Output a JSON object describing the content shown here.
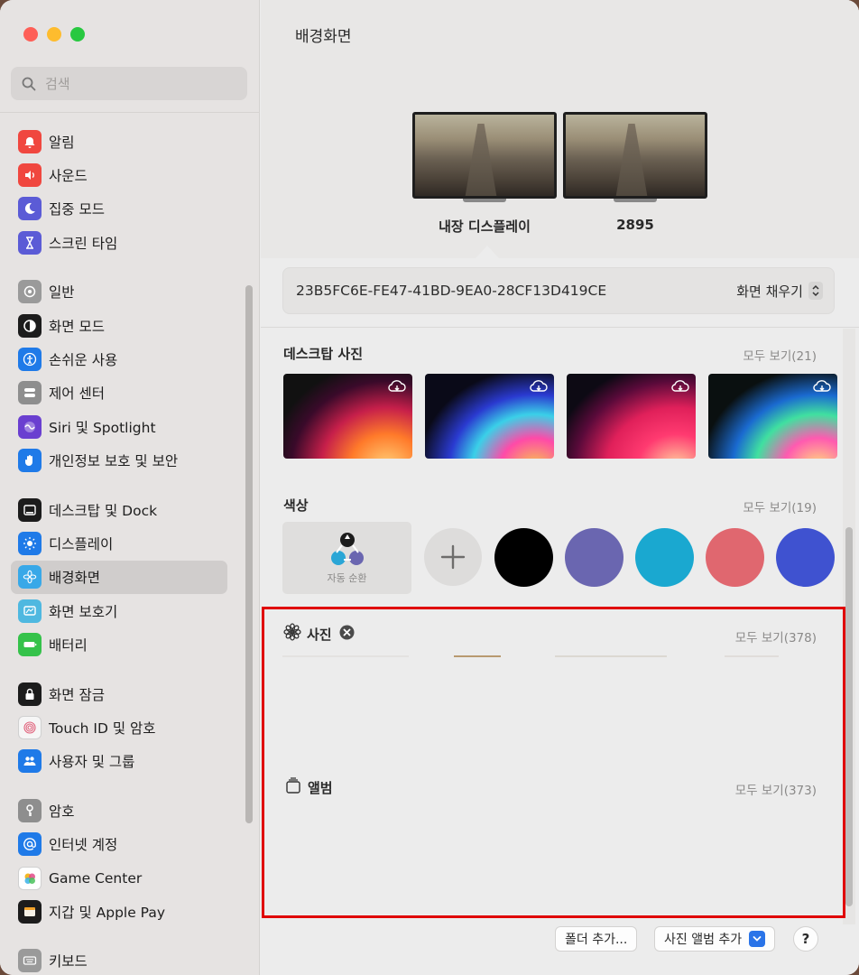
{
  "window": {
    "traffic_colors": [
      "#fe5f57",
      "#febc2e",
      "#28c840"
    ]
  },
  "search": {
    "placeholder": "검색"
  },
  "sidebar": {
    "groups": [
      [
        {
          "id": "notifications",
          "label": "알림",
          "icon": "bell-icon",
          "color": "#f0473f"
        },
        {
          "id": "sound",
          "label": "사운드",
          "icon": "speaker-icon",
          "color": "#f0473f"
        },
        {
          "id": "focus",
          "label": "집중 모드",
          "icon": "moon-icon",
          "color": "#5b5bd6"
        },
        {
          "id": "screen-time",
          "label": "스크린 타임",
          "icon": "hourglass-icon",
          "color": "#5b5bd6"
        }
      ],
      [
        {
          "id": "general",
          "label": "일반",
          "icon": "gear-icon",
          "color": "#9a9a9a"
        },
        {
          "id": "appearance",
          "label": "화면 모드",
          "icon": "appearance-icon",
          "color": "#1c1c1c"
        },
        {
          "id": "accessibility",
          "label": "손쉬운 사용",
          "icon": "accessibility-icon",
          "color": "#1f7ae8"
        },
        {
          "id": "control-center",
          "label": "제어 센터",
          "icon": "control-center-icon",
          "color": "#8e8e8e"
        },
        {
          "id": "siri",
          "label": "Siri 및 Spotlight",
          "icon": "siri-icon",
          "color": "#6a3fd0"
        },
        {
          "id": "privacy",
          "label": "개인정보 보호 및 보안",
          "icon": "hand-icon",
          "color": "#1f7ae8"
        }
      ],
      [
        {
          "id": "desktop-dock",
          "label": "데스크탑 및 Dock",
          "icon": "dock-icon",
          "color": "#1c1c1c"
        },
        {
          "id": "displays",
          "label": "디스플레이",
          "icon": "sun-icon",
          "color": "#1f7ae8"
        },
        {
          "id": "wallpaper",
          "label": "배경화면",
          "icon": "flower-icon",
          "color": "#38a8e8",
          "active": true
        },
        {
          "id": "screensaver",
          "label": "화면 보호기",
          "icon": "screensaver-icon",
          "color": "#4fb8e0"
        },
        {
          "id": "battery",
          "label": "배터리",
          "icon": "battery-icon",
          "color": "#35c24a"
        }
      ],
      [
        {
          "id": "lock-screen",
          "label": "화면 잠금",
          "icon": "lock-icon",
          "color": "#1c1c1c"
        },
        {
          "id": "touch-id",
          "label": "Touch ID 및 암호",
          "icon": "fingerprint-icon",
          "color": "#f6f6f6"
        },
        {
          "id": "users",
          "label": "사용자 및 그룹",
          "icon": "users-icon",
          "color": "#1f7ae8"
        }
      ],
      [
        {
          "id": "passwords",
          "label": "암호",
          "icon": "key-icon",
          "color": "#8e8e8e"
        },
        {
          "id": "internet-accounts",
          "label": "인터넷 계정",
          "icon": "at-icon",
          "color": "#1f7ae8"
        },
        {
          "id": "game-center",
          "label": "Game Center",
          "icon": "game-center-icon",
          "color": "#ffffff"
        },
        {
          "id": "wallet",
          "label": "지갑 및 Apple Pay",
          "icon": "wallet-icon",
          "color": "#1c1c1c"
        }
      ],
      [
        {
          "id": "keyboard",
          "label": "키보드",
          "icon": "keyboard-icon",
          "color": "#9a9a9a"
        }
      ]
    ]
  },
  "main": {
    "title": "배경화면",
    "displays": [
      {
        "label": "내장 디스플레이"
      },
      {
        "label": "2895"
      }
    ],
    "selector": {
      "wallpaper_id": "23B5FC6E-FE47-41BD-9EA0-28CF13D419CE",
      "fit_label": "화면 채우기"
    },
    "desktop_pictures": {
      "title": "데스크탑 사진",
      "see_all": "모두 보기(21)"
    },
    "colors": {
      "title": "색상",
      "see_all": "모두 보기(19)",
      "auto_rotate_label": "자동 순환",
      "swatches": [
        "#000000",
        "#6a66b0",
        "#1aa8d0",
        "#e0676f",
        "#3f52d0"
      ]
    },
    "photos": {
      "title": "사진",
      "see_all": "모두 보기(378)"
    },
    "albums": {
      "title": "앨범",
      "see_all": "모두 보기(373)"
    },
    "buttons": {
      "add_folder": "폴더 추가...",
      "add_album": "사진 앨범 추가",
      "help": "?"
    }
  }
}
